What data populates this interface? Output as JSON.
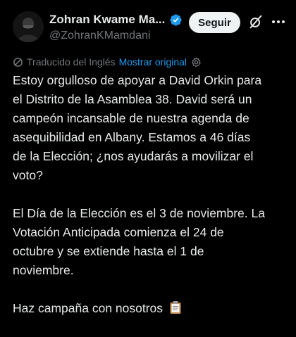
{
  "author": {
    "display_name": "Zohran Kwame Ma...",
    "handle": "@ZohranKMamdani",
    "verified_color": "#1d9bf0"
  },
  "actions": {
    "follow_label": "Seguir",
    "grok_icon": "grok-icon",
    "more_icon": "more-icon"
  },
  "translation": {
    "label": "Traducido del Inglés",
    "show_original": "Mostrar original"
  },
  "tweet": {
    "paragraphs": [
      [
        "Estoy orgulloso de apoyar a David Orkin para",
        "el Distrito de la Asamblea 38. David será un",
        "campeón incansable de nuestra agenda de",
        "asequibilidad en Albany. Estamos a 46 días",
        "de la Elección; ¿nos ayudarás a movilizar el",
        "voto?"
      ],
      [
        "El Día de la Elección es el 3 de noviembre. La",
        "Votación Anticipada comienza el 24 de",
        "octubre y se extiende hasta el 1 de",
        "noviembre."
      ],
      [
        "Haz campaña con nosotros"
      ]
    ],
    "trailing_emoji": "clipboard-icon"
  },
  "colors": {
    "background": "#000000",
    "text": "#e7e9ea",
    "muted": "#71767b",
    "accent": "#1d9bf0",
    "button_bg": "#eff3f4"
  }
}
